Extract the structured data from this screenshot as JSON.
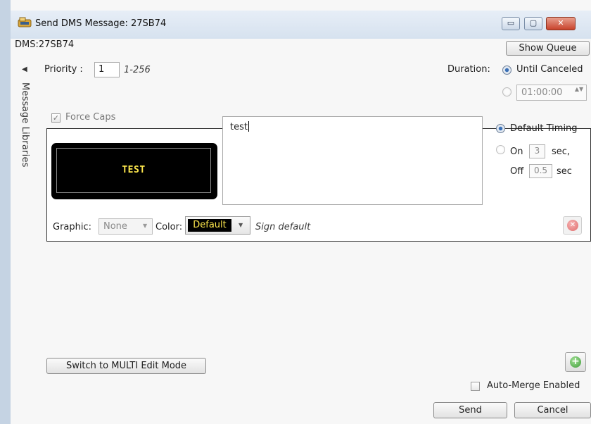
{
  "window": {
    "title": "Send DMS Message: 27SB74",
    "minimize_glyph": "▭",
    "maximize_glyph": "▢",
    "close_glyph": "✕"
  },
  "dms_label": "DMS:27SB74",
  "show_queue_label": "Show Queue",
  "sidebar": {
    "label": "Message Libraries",
    "collapse_glyph": "◀"
  },
  "priority": {
    "label": "Priority :",
    "value": "1",
    "range": "1-256"
  },
  "duration": {
    "label": "Duration:",
    "until_canceled_label": "Until Canceled",
    "until_canceled_selected": true,
    "time_value": "01:00:00",
    "spin_glyph": "▲▼"
  },
  "force_caps": {
    "label": "Force Caps",
    "checked": true,
    "check_glyph": "✓"
  },
  "message": {
    "sign_preview_text": "TEST",
    "text": "test",
    "colors": {
      "sign_background": "#000000",
      "sign_text": "#ffe94d"
    }
  },
  "timing": {
    "default_label": "Default Timing",
    "default_selected": true,
    "on_label": "On",
    "on_value": "3",
    "on_unit": "sec,",
    "off_label": "Off",
    "off_value": "0.5",
    "off_unit": "sec"
  },
  "graphic": {
    "label": "Graphic:",
    "selected": "None",
    "dropdown_glyph": "▼"
  },
  "color": {
    "label": "Color:",
    "selected": "Default",
    "note": "Sign default",
    "dropdown_glyph": "▼"
  },
  "remove_glyph": "✕",
  "add_glyph": "+",
  "multi_edit_label": "Switch to MULTI Edit Mode",
  "auto_merge": {
    "label": "Auto-Merge Enabled",
    "checked": false
  },
  "actions": {
    "send": "Send",
    "cancel": "Cancel"
  }
}
